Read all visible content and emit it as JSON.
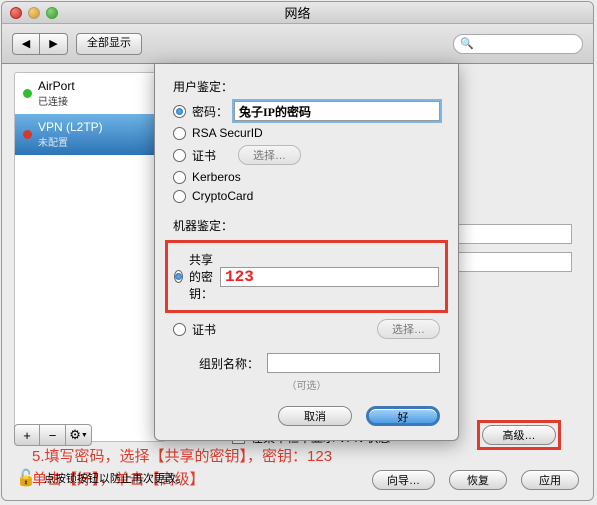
{
  "window": {
    "title": "网络"
  },
  "toolbar": {
    "show_all": "全部显示",
    "search_placeholder": ""
  },
  "sidebar": {
    "items": [
      {
        "title": "AirPort",
        "sub": "已连接"
      },
      {
        "title": "VPN (L2TP)",
        "sub": "未配置"
      }
    ]
  },
  "sheet": {
    "user_auth_label": "用户鉴定：",
    "radios": {
      "password": "密码：",
      "rsa": "RSA SecurID",
      "cert": "证书",
      "kerberos": "Kerberos",
      "cryptocard": "CryptoCard"
    },
    "password_value": "兔子IP的密码",
    "choose_btn": "选择…",
    "machine_auth_label": "机器鉴定：",
    "shared_key_label": "共享的密钥：",
    "shared_key_value": "123",
    "cert2": "证书",
    "choose_btn2": "选择…",
    "group_name_label": "组别名称：",
    "optional_label": "（可选）",
    "cancel_btn": "取消",
    "ok_btn": "好"
  },
  "annotation": {
    "line1": "5.填写密码，选择【共享的密钥】，密钥：123",
    "line2": "单击【好】，单击【高级】"
  },
  "status_checkbox_label": "在菜单栏中显示 VPN 状态",
  "advanced_btn": "高级…",
  "lock_text": "点按锁按钮以防止再次更改。",
  "bottom": {
    "wizard": "向导…",
    "restore": "恢复",
    "apply": "应用"
  },
  "icons": {
    "gear": "⚙",
    "plus": "+",
    "minus": "−",
    "back": "◀",
    "fwd": "▶",
    "search": "🔍",
    "lock": "🔓"
  }
}
